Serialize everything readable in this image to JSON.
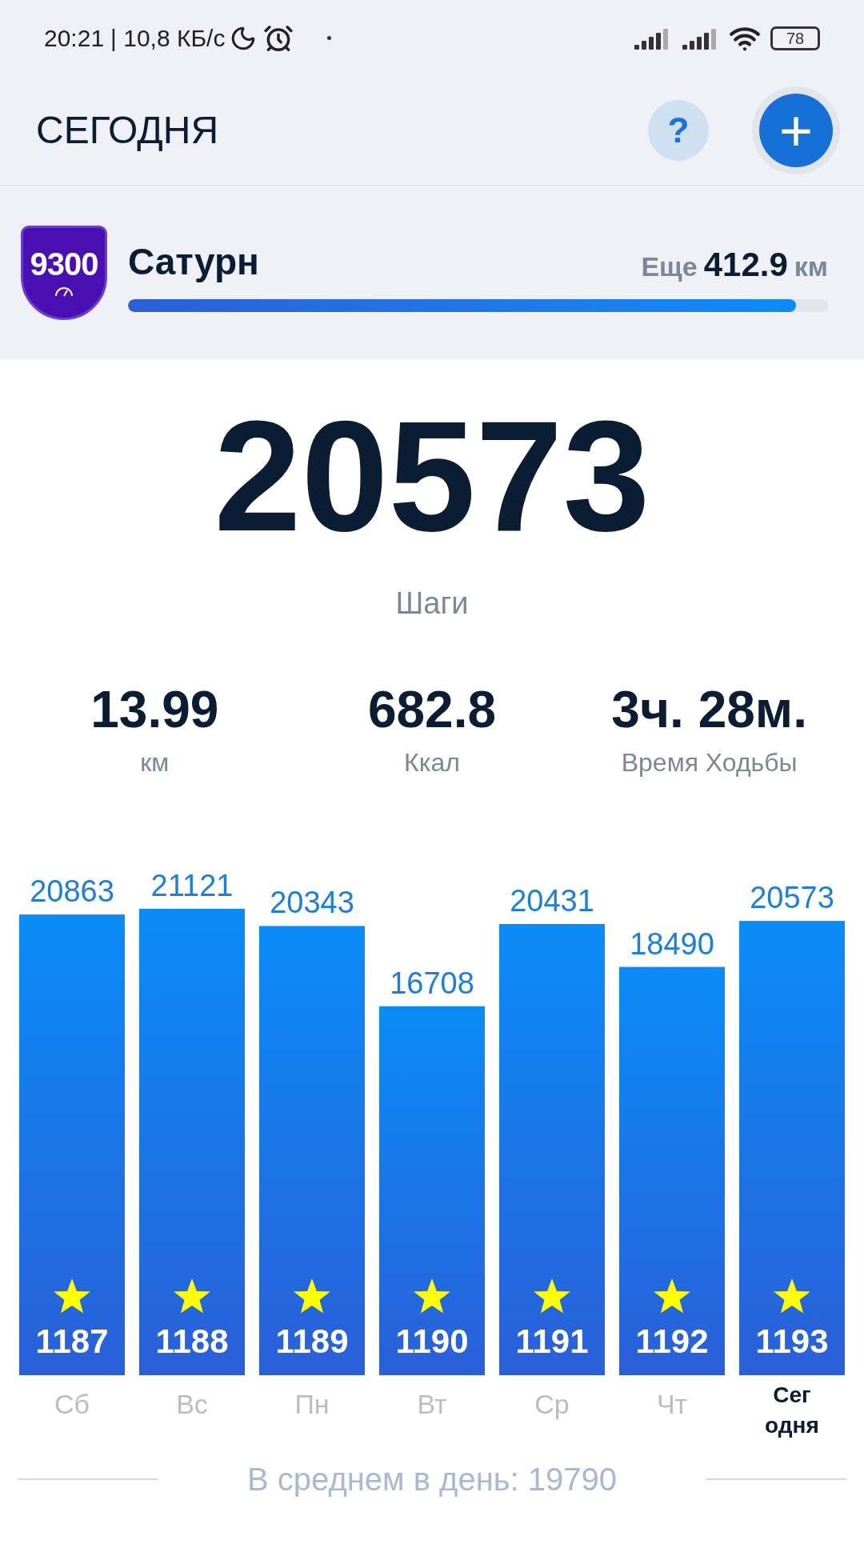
{
  "status_bar": {
    "time": "20:21",
    "speed": "| 10,8 КБ/с",
    "battery": "78"
  },
  "header": {
    "title": "СЕГОДНЯ",
    "help_label": "?",
    "add_label": "+"
  },
  "goal": {
    "badge": "9300",
    "name": "Сатурн",
    "remaining_prefix": "Еще",
    "remaining_value": "412.9",
    "remaining_unit": "км",
    "level": 0.954
  },
  "steps": {
    "value": "20573",
    "label": "Шаги"
  },
  "stats": [
    {
      "value": "13.99",
      "label": "км"
    },
    {
      "value": "682.8",
      "label": "Ккал"
    },
    {
      "value": "3ч. 28м.",
      "label": "Время Ходьбы"
    }
  ],
  "week": {
    "chart_data": {
      "type": "bar",
      "categories": [
        "Сб",
        "Вс",
        "Пн",
        "Вт",
        "Ср",
        "Чт",
        "Сегодня"
      ],
      "series": [
        {
          "color": "#0a8cf7",
          "values": [
            20863,
            21121,
            20343,
            16708,
            20431,
            18490,
            20573
          ]
        }
      ],
      "data_labels": true
    },
    "days": [
      {
        "streak": "1187",
        "selected": false
      },
      {
        "streak": "1188",
        "selected": false
      },
      {
        "streak": "1189",
        "selected": false
      },
      {
        "streak": "1190",
        "selected": false
      },
      {
        "streak": "1191",
        "selected": false
      },
      {
        "streak": "1192",
        "selected": false
      },
      {
        "streak": "1193",
        "selected": true
      }
    ],
    "average": "В среднем в день: 19790"
  }
}
